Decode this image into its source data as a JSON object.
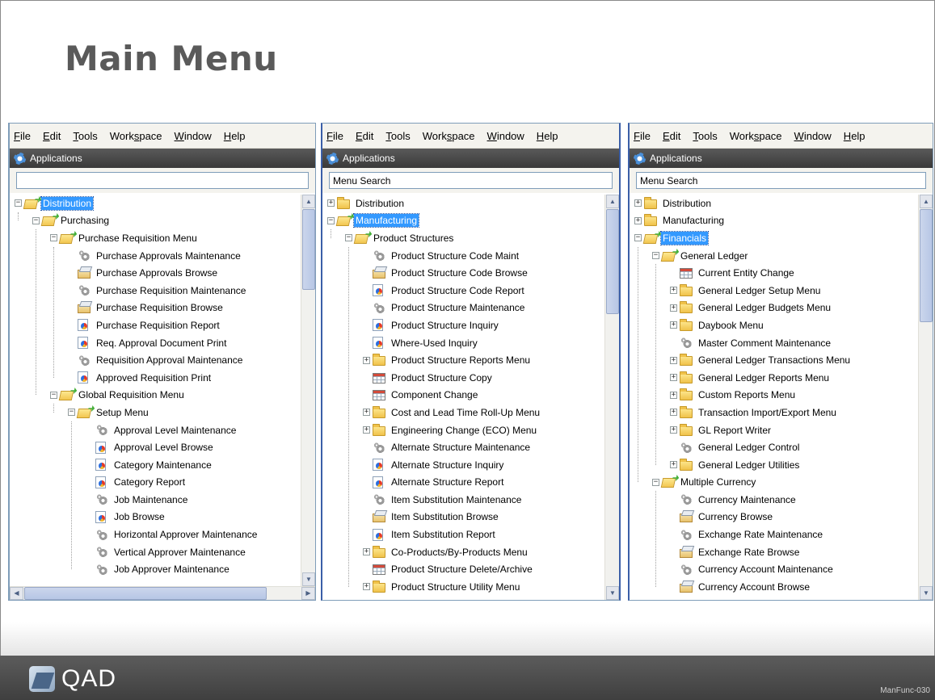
{
  "slide": {
    "title": "Main Menu",
    "brand": "QAD",
    "code": "ManFunc-030"
  },
  "windows": [
    {
      "menu": [
        "File",
        "Edit",
        "Tools",
        "Workspace",
        "Window",
        "Help"
      ],
      "app_title": "Applications",
      "search": {
        "value": "",
        "placeholder": ""
      },
      "tree": [
        {
          "level": 0,
          "expander": "-",
          "icon": "open-folder-icon",
          "label": "Distribution",
          "selected": true
        },
        {
          "level": 1,
          "expander": "-",
          "icon": "open-folder-icon",
          "label": "Purchasing"
        },
        {
          "level": 2,
          "expander": "-",
          "icon": "open-folder-icon",
          "label": "Purchase Requisition Menu"
        },
        {
          "level": 3,
          "expander": "",
          "icon": "gear-icon",
          "label": "Purchase Approvals Maintenance"
        },
        {
          "level": 3,
          "expander": "",
          "icon": "browse-icon",
          "label": "Purchase Approvals Browse"
        },
        {
          "level": 3,
          "expander": "",
          "icon": "gear-icon",
          "label": "Purchase Requisition Maintenance"
        },
        {
          "level": 3,
          "expander": "",
          "icon": "browse-icon",
          "label": "Purchase Requisition Browse"
        },
        {
          "level": 3,
          "expander": "",
          "icon": "report-icon",
          "label": "Purchase Requisition Report"
        },
        {
          "level": 3,
          "expander": "",
          "icon": "report-icon",
          "label": "Req. Approval Document Print"
        },
        {
          "level": 3,
          "expander": "",
          "icon": "gear-icon",
          "label": "Requisition Approval Maintenance"
        },
        {
          "level": 3,
          "expander": "",
          "icon": "report-icon",
          "label": "Approved Requisition Print"
        },
        {
          "level": 2,
          "expander": "-",
          "icon": "open-folder-icon",
          "label": "Global Requisition Menu"
        },
        {
          "level": 3,
          "expander": "-",
          "icon": "open-folder-icon",
          "label": "Setup Menu"
        },
        {
          "level": 4,
          "expander": "",
          "icon": "gear-icon",
          "label": "Approval Level Maintenance"
        },
        {
          "level": 4,
          "expander": "",
          "icon": "report-icon",
          "label": "Approval Level Browse"
        },
        {
          "level": 4,
          "expander": "",
          "icon": "report-icon",
          "label": "Category Maintenance"
        },
        {
          "level": 4,
          "expander": "",
          "icon": "report-icon",
          "label": "Category Report"
        },
        {
          "level": 4,
          "expander": "",
          "icon": "gear-icon",
          "label": "Job Maintenance"
        },
        {
          "level": 4,
          "expander": "",
          "icon": "report-icon",
          "label": "Job Browse"
        },
        {
          "level": 4,
          "expander": "",
          "icon": "gear-icon",
          "label": "Horizontal Approver Maintenance"
        },
        {
          "level": 4,
          "expander": "",
          "icon": "gear-icon",
          "label": "Vertical Approver Maintenance"
        },
        {
          "level": 4,
          "expander": "",
          "icon": "gear-icon",
          "label": "Job Approver Maintenance"
        }
      ],
      "has_hscroll": true
    },
    {
      "menu": [
        "File",
        "Edit",
        "Tools",
        "Workspace",
        "Window",
        "Help"
      ],
      "app_title": "Applications",
      "search": {
        "value": "Menu Search",
        "placeholder": ""
      },
      "tree": [
        {
          "level": 0,
          "expander": "+",
          "icon": "folder-icon",
          "label": "Distribution"
        },
        {
          "level": 0,
          "expander": "-",
          "icon": "open-folder-icon",
          "label": "Manufacturing",
          "selected": true
        },
        {
          "level": 1,
          "expander": "-",
          "icon": "open-folder-icon",
          "label": "Product Structures"
        },
        {
          "level": 2,
          "expander": "",
          "icon": "gear-icon",
          "label": "Product Structure Code Maint"
        },
        {
          "level": 2,
          "expander": "",
          "icon": "browse-icon",
          "label": "Product Structure Code Browse"
        },
        {
          "level": 2,
          "expander": "",
          "icon": "report-icon",
          "label": "Product Structure Code Report"
        },
        {
          "level": 2,
          "expander": "",
          "icon": "gear-icon",
          "label": "Product Structure Maintenance"
        },
        {
          "level": 2,
          "expander": "",
          "icon": "report-icon",
          "label": "Product Structure Inquiry"
        },
        {
          "level": 2,
          "expander": "",
          "icon": "report-icon",
          "label": "Where-Used Inquiry"
        },
        {
          "level": 2,
          "expander": "+",
          "icon": "folder-icon",
          "label": "Product Structure Reports Menu"
        },
        {
          "level": 2,
          "expander": "",
          "icon": "grid-icon",
          "label": "Product Structure Copy"
        },
        {
          "level": 2,
          "expander": "",
          "icon": "grid-icon",
          "label": "Component Change"
        },
        {
          "level": 2,
          "expander": "+",
          "icon": "folder-icon",
          "label": "Cost and Lead Time Roll-Up Menu"
        },
        {
          "level": 2,
          "expander": "+",
          "icon": "folder-icon",
          "label": "Engineering Change (ECO) Menu"
        },
        {
          "level": 2,
          "expander": "",
          "icon": "gear-icon",
          "label": "Alternate Structure Maintenance"
        },
        {
          "level": 2,
          "expander": "",
          "icon": "report-icon",
          "label": "Alternate Structure Inquiry"
        },
        {
          "level": 2,
          "expander": "",
          "icon": "report-icon",
          "label": "Alternate Structure Report"
        },
        {
          "level": 2,
          "expander": "",
          "icon": "gear-icon",
          "label": "Item Substitution Maintenance"
        },
        {
          "level": 2,
          "expander": "",
          "icon": "browse-icon",
          "label": "Item Substitution Browse"
        },
        {
          "level": 2,
          "expander": "",
          "icon": "report-icon",
          "label": "Item Substitution Report"
        },
        {
          "level": 2,
          "expander": "+",
          "icon": "folder-icon",
          "label": "Co-Products/By-Products Menu"
        },
        {
          "level": 2,
          "expander": "",
          "icon": "grid-icon",
          "label": "Product Structure Delete/Archive"
        },
        {
          "level": 2,
          "expander": "+",
          "icon": "folder-icon",
          "label": "Product Structure Utility Menu"
        }
      ],
      "has_hscroll": false
    },
    {
      "menu": [
        "File",
        "Edit",
        "Tools",
        "Workspace",
        "Window",
        "Help"
      ],
      "app_title": "Applications",
      "search": {
        "value": "Menu Search",
        "placeholder": ""
      },
      "tree": [
        {
          "level": 0,
          "expander": "+",
          "icon": "folder-icon",
          "label": "Distribution"
        },
        {
          "level": 0,
          "expander": "+",
          "icon": "folder-icon",
          "label": "Manufacturing"
        },
        {
          "level": 0,
          "expander": "-",
          "icon": "open-folder-icon",
          "label": "Financials",
          "selected": true
        },
        {
          "level": 1,
          "expander": "-",
          "icon": "open-folder-icon",
          "label": "General Ledger"
        },
        {
          "level": 2,
          "expander": "",
          "icon": "grid-icon",
          "label": "Current Entity Change"
        },
        {
          "level": 2,
          "expander": "+",
          "icon": "folder-icon",
          "label": "General Ledger Setup Menu"
        },
        {
          "level": 2,
          "expander": "+",
          "icon": "folder-icon",
          "label": "General Ledger Budgets Menu"
        },
        {
          "level": 2,
          "expander": "+",
          "icon": "folder-icon",
          "label": "Daybook Menu"
        },
        {
          "level": 2,
          "expander": "",
          "icon": "gear-icon",
          "label": "Master Comment Maintenance"
        },
        {
          "level": 2,
          "expander": "+",
          "icon": "folder-icon",
          "label": "General Ledger Transactions Menu"
        },
        {
          "level": 2,
          "expander": "+",
          "icon": "folder-icon",
          "label": "General Ledger Reports Menu"
        },
        {
          "level": 2,
          "expander": "+",
          "icon": "folder-icon",
          "label": "Custom Reports Menu"
        },
        {
          "level": 2,
          "expander": "+",
          "icon": "folder-icon",
          "label": "Transaction Import/Export Menu"
        },
        {
          "level": 2,
          "expander": "+",
          "icon": "folder-icon",
          "label": "GL Report Writer"
        },
        {
          "level": 2,
          "expander": "",
          "icon": "gear-icon",
          "label": "General Ledger Control"
        },
        {
          "level": 2,
          "expander": "+",
          "icon": "folder-icon",
          "label": "General Ledger Utilities"
        },
        {
          "level": 1,
          "expander": "-",
          "icon": "open-folder-icon",
          "label": "Multiple Currency"
        },
        {
          "level": 2,
          "expander": "",
          "icon": "gear-icon",
          "label": "Currency Maintenance"
        },
        {
          "level": 2,
          "expander": "",
          "icon": "browse-icon",
          "label": "Currency Browse"
        },
        {
          "level": 2,
          "expander": "",
          "icon": "gear-icon",
          "label": "Exchange Rate Maintenance"
        },
        {
          "level": 2,
          "expander": "",
          "icon": "browse-icon",
          "label": "Exchange Rate Browse"
        },
        {
          "level": 2,
          "expander": "",
          "icon": "gear-icon",
          "label": "Currency Account Maintenance"
        },
        {
          "level": 2,
          "expander": "",
          "icon": "browse-icon",
          "label": "Currency Account Browse"
        }
      ],
      "has_hscroll": false
    }
  ]
}
